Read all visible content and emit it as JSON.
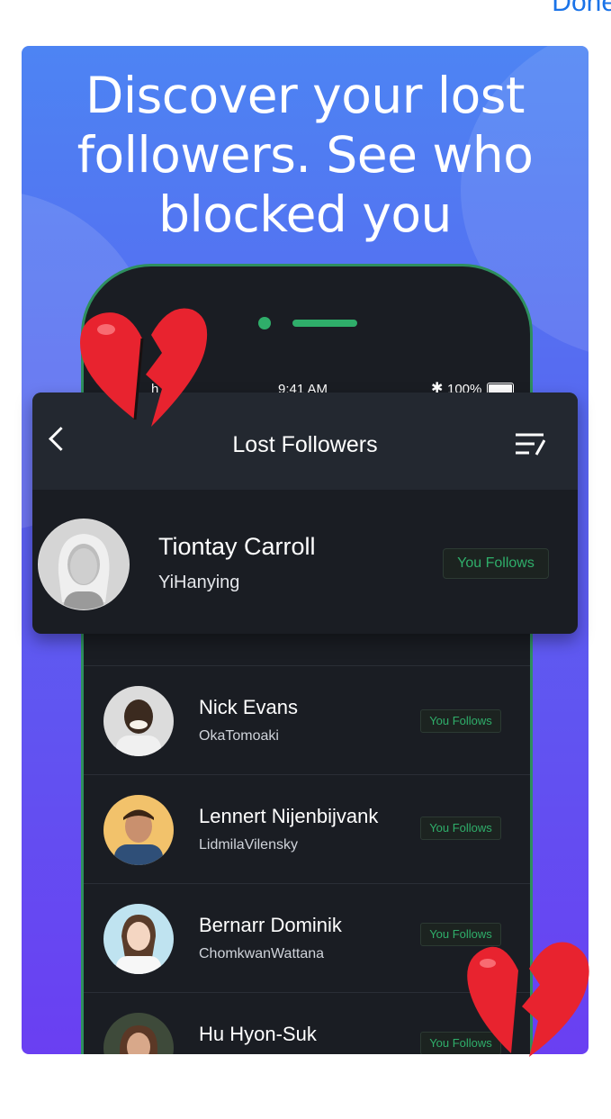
{
  "top_bar": {
    "done_label": "Done"
  },
  "headline": "Discover your lost followers. See who blocked you",
  "status_bar": {
    "carrier": "h",
    "time": "9:41 AM",
    "battery": "100%"
  },
  "screen": {
    "title": "Lost Followers",
    "featured": {
      "name": "Tiontay Carroll",
      "username": "YiHanying",
      "tag": "You Follows"
    },
    "rows": [
      {
        "name": "Nick Evans",
        "username": "OkaTomoaki",
        "tag": "You Follows"
      },
      {
        "name": "Lennert Nijenbijvank",
        "username": "LidmilaVilensky",
        "tag": "You Follows"
      },
      {
        "name": "Bernarr Dominik",
        "username": "ChomkwanWattana",
        "tag": "You Follows"
      },
      {
        "name": "Hu Hyon-Suk",
        "username": "",
        "tag": "You Follows"
      }
    ]
  },
  "colors": {
    "accent_green": "#2fae6a",
    "card_top": "#4d84f3",
    "card_bottom": "#6a3ff2",
    "heart_red": "#e8232f"
  }
}
